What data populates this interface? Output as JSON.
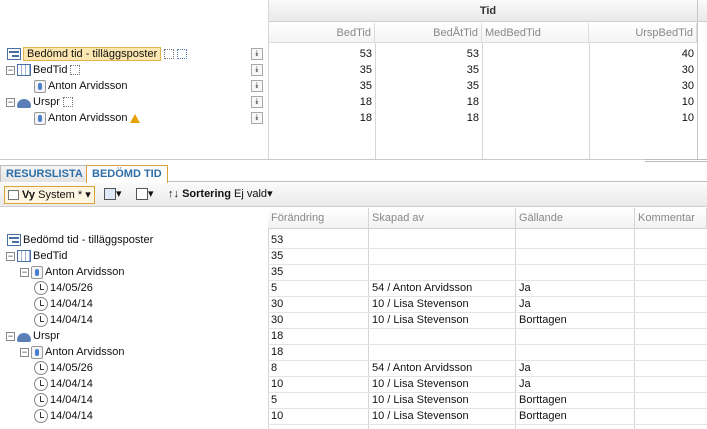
{
  "top_grid": {
    "group_header": "Tid",
    "columns": [
      "BedTid",
      "BedÅtTid",
      "MedBedTid",
      "UrspBedTid"
    ],
    "rows": [
      {
        "label": "Bedömd tid - tilläggsposter",
        "icon": "structure-icon",
        "values": [
          "53",
          "53",
          "",
          "40"
        ]
      },
      {
        "label": "BedTid",
        "icon": "grid-icon",
        "values": [
          "35",
          "35",
          "",
          "30"
        ]
      },
      {
        "label": "Anton Arvidsson",
        "icon": "person-icon",
        "values": [
          "35",
          "35",
          "",
          "30"
        ]
      },
      {
        "label": "Urspr",
        "icon": "org-icon",
        "values": [
          "18",
          "18",
          "",
          "10"
        ]
      },
      {
        "label": "Anton Arvidsson",
        "icon": "person-icon",
        "values": [
          "18",
          "18",
          "",
          "10"
        ]
      }
    ]
  },
  "tabs": [
    "RESURSLISTA",
    "BEDÖMD TID"
  ],
  "toolbar": {
    "vy_label": "Vy",
    "vy_value": "System *",
    "sort_label": "Sortering",
    "sort_value": "Ej vald"
  },
  "bottom_grid": {
    "columns": [
      "Förändring",
      "Skapad av",
      "Gällande",
      "Kommentar"
    ],
    "rows": [
      {
        "label": "Bedömd tid - tilläggsposter",
        "icon": "structure-icon",
        "values": [
          "53",
          "",
          "",
          ""
        ]
      },
      {
        "label": "BedTid",
        "icon": "grid-icon",
        "values": [
          "35",
          "",
          "",
          ""
        ]
      },
      {
        "label": "Anton Arvidsson",
        "icon": "person-icon",
        "values": [
          "35",
          "",
          "",
          ""
        ]
      },
      {
        "label": "14/05/26",
        "icon": "clock-icon",
        "values": [
          "5",
          "54 / Anton Arvidsson",
          "Ja",
          ""
        ]
      },
      {
        "label": "14/04/14",
        "icon": "clock-icon",
        "values": [
          "30",
          "10 / Lisa Stevenson",
          "Ja",
          ""
        ]
      },
      {
        "label": "14/04/14",
        "icon": "clock-icon",
        "values": [
          "30",
          "10 / Lisa Stevenson",
          "Borttagen",
          ""
        ]
      },
      {
        "label": "Urspr",
        "icon": "org-icon",
        "values": [
          "18",
          "",
          "",
          ""
        ]
      },
      {
        "label": "Anton Arvidsson",
        "icon": "person-icon",
        "values": [
          "18",
          "",
          "",
          ""
        ]
      },
      {
        "label": "14/05/26",
        "icon": "clock-icon",
        "values": [
          "8",
          "54 / Anton Arvidsson",
          "Ja",
          ""
        ]
      },
      {
        "label": "14/04/14",
        "icon": "clock-icon",
        "values": [
          "10",
          "10 / Lisa Stevenson",
          "Ja",
          ""
        ]
      },
      {
        "label": "14/04/14",
        "icon": "clock-icon",
        "values": [
          "5",
          "10 / Lisa Stevenson",
          "Borttagen",
          ""
        ]
      },
      {
        "label": "14/04/14",
        "icon": "clock-icon",
        "values": [
          "10",
          "10 / Lisa Stevenson",
          "Borttagen",
          ""
        ]
      }
    ]
  }
}
